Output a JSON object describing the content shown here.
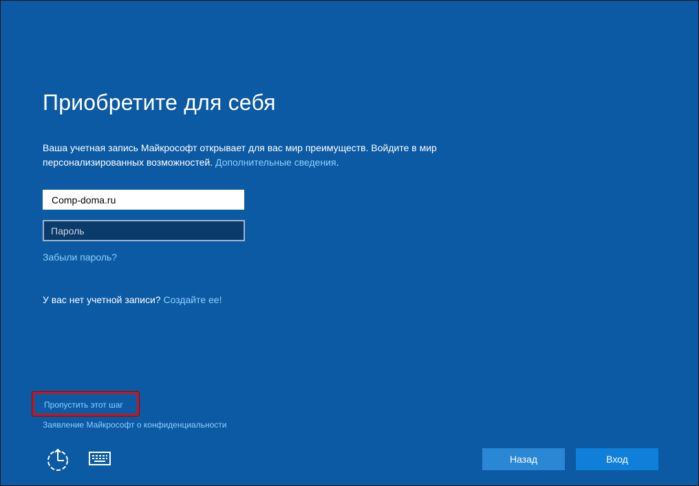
{
  "page": {
    "title": "Приобретите для себя",
    "description": "Ваша учетная запись Майкрософт открывает для вас мир преимуществ. Войдите в мир персонализированных возможностей.",
    "more_info_link": "Дополнительные сведения",
    "more_info_suffix": "."
  },
  "form": {
    "email_value": "Comp-doma.ru",
    "password_placeholder": "Пароль",
    "forgot_password": "Забыли пароль?"
  },
  "signup": {
    "prompt": "У вас нет учетной записи?",
    "link": "Создайте ее!"
  },
  "footer": {
    "skip_step": "Пропустить этот шаг",
    "privacy": "Заявление Майкрософт о конфиденциальности",
    "icons": [
      "ease-of-access-icon",
      "keyboard-icon"
    ],
    "back_button": "Назад",
    "signin_button": "Вход"
  },
  "colors": {
    "background": "#0b5aa3",
    "link": "#8fcfff",
    "highlight_box": "#c4181f",
    "back_button": "#2a87d4",
    "signin_button": "#0f7fd9"
  }
}
